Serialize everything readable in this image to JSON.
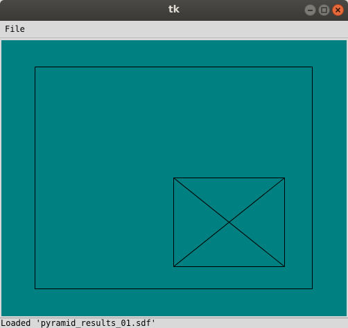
{
  "window": {
    "title": "tk"
  },
  "menubar": {
    "file_label": "File"
  },
  "canvas": {
    "background": "#008080",
    "line_color": "#000000"
  },
  "statusbar": {
    "text": "Loaded 'pyramid_results_01.sdf'"
  },
  "icons": {
    "minimize": "minimize-icon",
    "maximize": "maximize-icon",
    "close": "close-icon"
  }
}
